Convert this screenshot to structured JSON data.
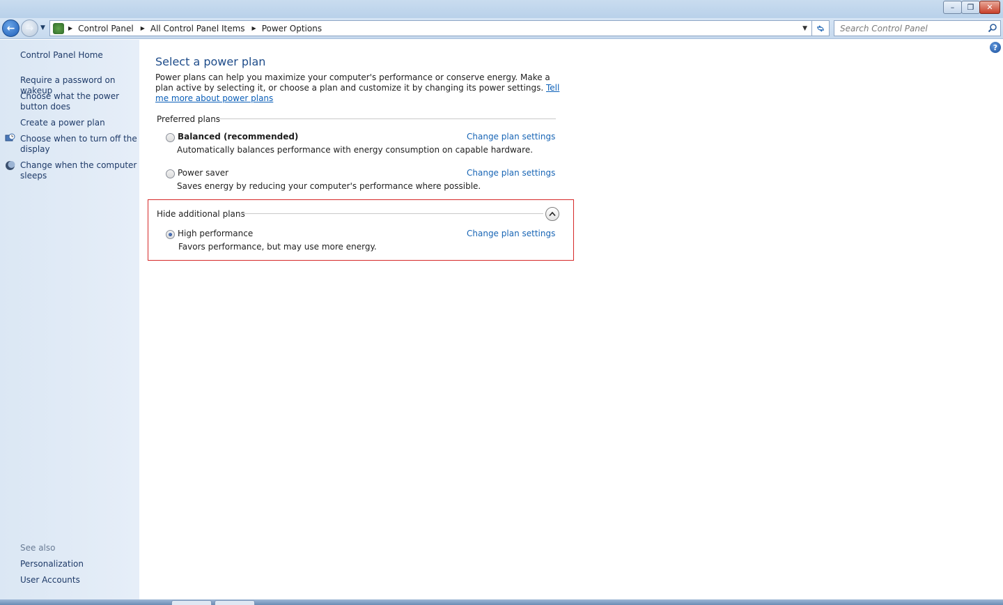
{
  "window": {
    "minimize_glyph": "–",
    "restore_glyph": "❐",
    "close_glyph": "✕"
  },
  "address_bar": {
    "back_glyph": "←",
    "forward_glyph": "→",
    "breadcrumbs": [
      "Control Panel",
      "All Control Panel Items",
      "Power Options"
    ],
    "search_placeholder": "Search Control Panel"
  },
  "sidebar": {
    "home": "Control Panel Home",
    "items": [
      {
        "label": "Require a password on wakeup",
        "icon": "none"
      },
      {
        "label": "Choose what the power button does",
        "icon": "none"
      },
      {
        "label": "Create a power plan",
        "icon": "none"
      },
      {
        "label": "Choose when to turn off the display",
        "icon": "display-clock-icon"
      },
      {
        "label": "Change when the computer sleeps",
        "icon": "moon-icon"
      }
    ],
    "see_also_header": "See also",
    "see_also": [
      "Personalization",
      "User Accounts"
    ]
  },
  "main": {
    "help_glyph": "?",
    "title": "Select a power plan",
    "intro_text": "Power plans can help you maximize your computer's performance or conserve energy. Make a plan active by selecting it, or choose a plan and customize it by changing its power settings. ",
    "intro_link": "Tell me more about power plans",
    "preferred_header": "Preferred plans",
    "preferred_plans": [
      {
        "name": "Balanced (recommended)",
        "description": "Automatically balances performance with energy consumption on capable hardware.",
        "link": "Change plan settings",
        "selected": false
      },
      {
        "name": "Power saver",
        "description": "Saves energy by reducing your computer's performance where possible.",
        "link": "Change plan settings",
        "selected": false
      }
    ],
    "additional_header": "Hide additional plans",
    "additional_plans": [
      {
        "name": "High performance",
        "description": "Favors performance, but may use more energy.",
        "link": "Change plan settings",
        "selected": true
      }
    ]
  },
  "colors": {
    "link": "#1865b5",
    "title": "#1e4c8a",
    "highlight_border": "#d62828",
    "sidebar_bg": "#dbe7f4"
  }
}
